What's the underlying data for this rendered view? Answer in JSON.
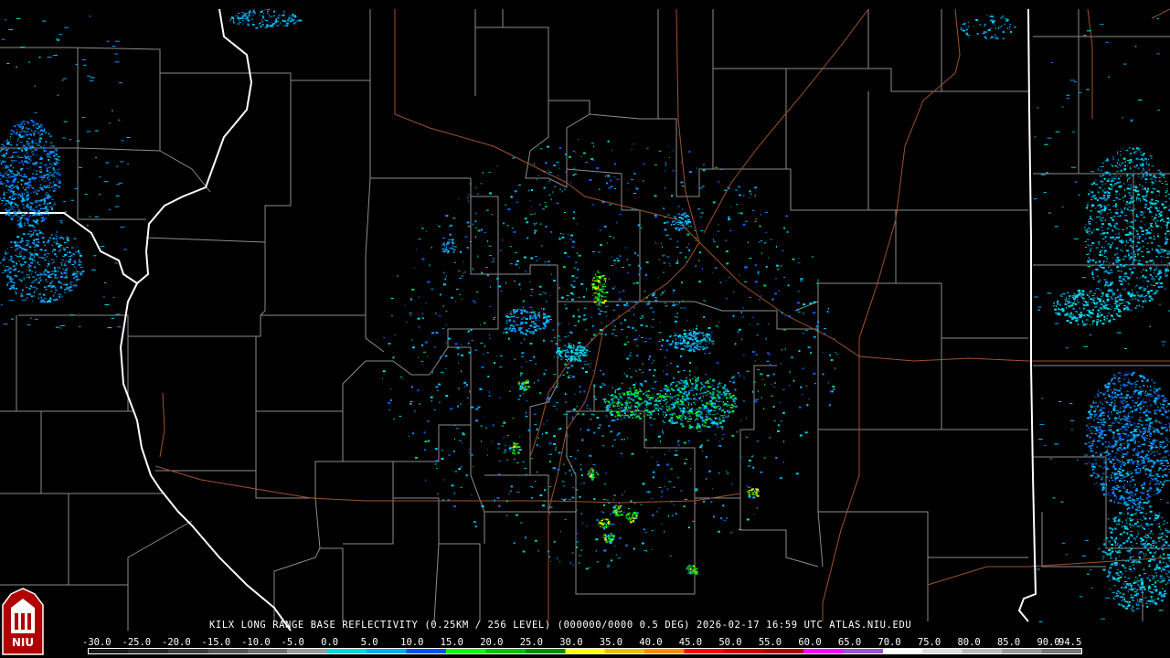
{
  "caption": "KILX LONG RANGE BASE REFLECTIVITY (0.25KM / 256 LEVEL) (000000/0000 0.5 DEG) 2026-02-17 16:59 UTC  ATLAS.NIU.EDU",
  "logo": {
    "text": "NIU",
    "icon": "niu-logo-icon"
  },
  "colors": {
    "background": "#000000",
    "state_border": "#ffffff",
    "county_border": "#8c8c8c",
    "highway": "#a0522d"
  },
  "scale": {
    "labels": [
      "-30.0",
      "-25.0",
      "-20.0",
      "-15.0",
      "-10.0",
      "-5.0",
      "0.0",
      "5.0",
      "10.0",
      "15.0",
      "20.0",
      "25.0",
      "30.0",
      "35.0",
      "40.0",
      "45.0",
      "50.0",
      "55.0",
      "60.0",
      "65.0",
      "70.0",
      "75.0",
      "80.0",
      "85.0",
      "90.0",
      "94.5"
    ],
    "colors": [
      "#1a1a1a",
      "#2a2a2a",
      "#3c3c3c",
      "#555555",
      "#707070",
      "#9a9a9a",
      "#00d8d8",
      "#00a8f0",
      "#0050f0",
      "#00ff00",
      "#00c000",
      "#008800",
      "#ffff00",
      "#e8c000",
      "#ff8c00",
      "#ff0000",
      "#d00000",
      "#b00000",
      "#ff00ff",
      "#9955cc",
      "#ffffff",
      "#dddddd",
      "#bbbbbb",
      "#999999",
      "#777777"
    ]
  }
}
